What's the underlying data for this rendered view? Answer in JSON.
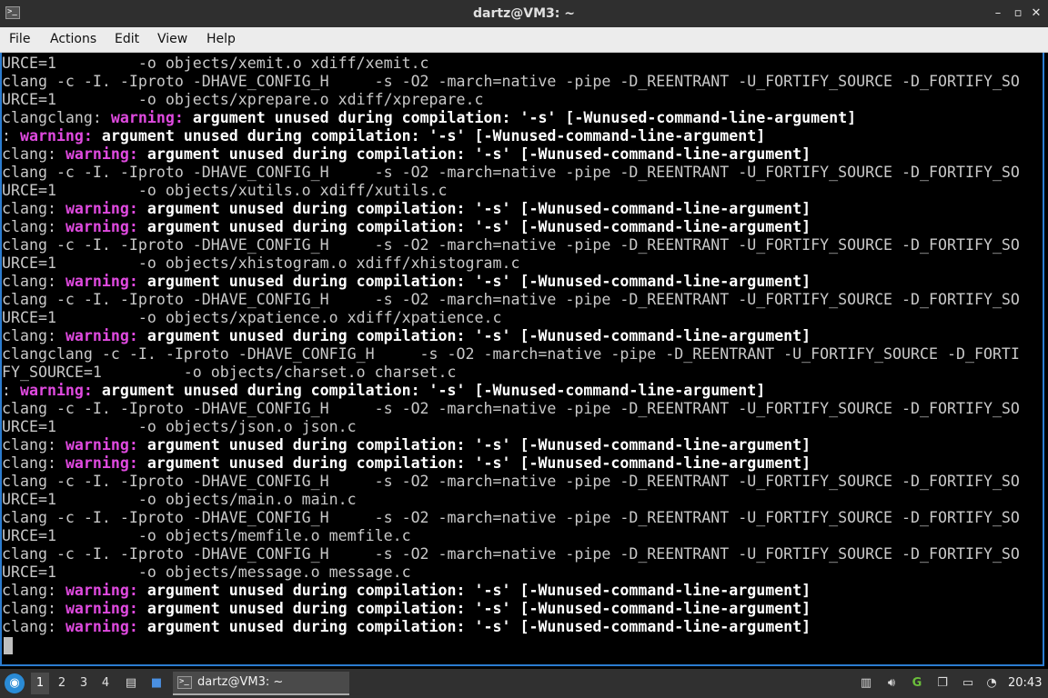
{
  "window": {
    "title": "dartz@VM3: ~",
    "minimize_icon": "minimize-icon",
    "maximize_icon": "maximize-icon",
    "close_icon": "close-icon"
  },
  "menu": [
    "File",
    "Actions",
    "Edit",
    "View",
    "Help"
  ],
  "terminal": {
    "lines": [
      [
        [
          "URCE=1         -o objects/xemit.o xdiff/xemit.c",
          "n"
        ]
      ],
      [
        [
          "clang -c -I. -Iproto -DHAVE_CONFIG_H     -s -O2 -march=native -pipe -D_REENTRANT -U_FORTIFY_SOURCE -D_FORTIFY_SO",
          "n"
        ]
      ],
      [
        [
          "URCE=1         -o objects/xprepare.o xdiff/xprepare.c",
          "n"
        ]
      ],
      [
        [
          "clangclang: ",
          "n"
        ],
        [
          "warning: ",
          "w"
        ],
        [
          "argument unused during compilation: '-s' [-Wunused-command-line-argument]",
          "b"
        ]
      ],
      [
        [
          ": ",
          "n"
        ],
        [
          "warning: ",
          "w"
        ],
        [
          "argument unused during compilation: '-s' [-Wunused-command-line-argument]",
          "b"
        ]
      ],
      [
        [
          "clang: ",
          "n"
        ],
        [
          "warning: ",
          "w"
        ],
        [
          "argument unused during compilation: '-s' [-Wunused-command-line-argument]",
          "b"
        ]
      ],
      [
        [
          "clang -c -I. -Iproto -DHAVE_CONFIG_H     -s -O2 -march=native -pipe -D_REENTRANT -U_FORTIFY_SOURCE -D_FORTIFY_SO",
          "n"
        ]
      ],
      [
        [
          "URCE=1         -o objects/xutils.o xdiff/xutils.c",
          "n"
        ]
      ],
      [
        [
          "clang: ",
          "n"
        ],
        [
          "warning: ",
          "w"
        ],
        [
          "argument unused during compilation: '-s' [-Wunused-command-line-argument]",
          "b"
        ]
      ],
      [
        [
          "clang: ",
          "n"
        ],
        [
          "warning: ",
          "w"
        ],
        [
          "argument unused during compilation: '-s' [-Wunused-command-line-argument]",
          "b"
        ]
      ],
      [
        [
          "clang -c -I. -Iproto -DHAVE_CONFIG_H     -s -O2 -march=native -pipe -D_REENTRANT -U_FORTIFY_SOURCE -D_FORTIFY_SO",
          "n"
        ]
      ],
      [
        [
          "URCE=1         -o objects/xhistogram.o xdiff/xhistogram.c",
          "n"
        ]
      ],
      [
        [
          "clang: ",
          "n"
        ],
        [
          "warning: ",
          "w"
        ],
        [
          "argument unused during compilation: '-s' [-Wunused-command-line-argument]",
          "b"
        ]
      ],
      [
        [
          "clang -c -I. -Iproto -DHAVE_CONFIG_H     -s -O2 -march=native -pipe -D_REENTRANT -U_FORTIFY_SOURCE -D_FORTIFY_SO",
          "n"
        ]
      ],
      [
        [
          "URCE=1         -o objects/xpatience.o xdiff/xpatience.c",
          "n"
        ]
      ],
      [
        [
          "clang: ",
          "n"
        ],
        [
          "warning: ",
          "w"
        ],
        [
          "argument unused during compilation: '-s' [-Wunused-command-line-argument]",
          "b"
        ]
      ],
      [
        [
          "clangclang -c -I. -Iproto -DHAVE_CONFIG_H     -s -O2 -march=native -pipe -D_REENTRANT -U_FORTIFY_SOURCE -D_FORTI",
          "n"
        ]
      ],
      [
        [
          "FY_SOURCE=1         -o objects/charset.o charset.c",
          "n"
        ]
      ],
      [
        [
          ": ",
          "n"
        ],
        [
          "warning: ",
          "w"
        ],
        [
          "argument unused during compilation: '-s' [-Wunused-command-line-argument]",
          "b"
        ]
      ],
      [
        [
          "clang -c -I. -Iproto -DHAVE_CONFIG_H     -s -O2 -march=native -pipe -D_REENTRANT -U_FORTIFY_SOURCE -D_FORTIFY_SO",
          "n"
        ]
      ],
      [
        [
          "URCE=1         -o objects/json.o json.c",
          "n"
        ]
      ],
      [
        [
          "clang: ",
          "n"
        ],
        [
          "warning: ",
          "w"
        ],
        [
          "argument unused during compilation: '-s' [-Wunused-command-line-argument]",
          "b"
        ]
      ],
      [
        [
          "clang: ",
          "n"
        ],
        [
          "warning: ",
          "w"
        ],
        [
          "argument unused during compilation: '-s' [-Wunused-command-line-argument]",
          "b"
        ]
      ],
      [
        [
          "clang -c -I. -Iproto -DHAVE_CONFIG_H     -s -O2 -march=native -pipe -D_REENTRANT -U_FORTIFY_SOURCE -D_FORTIFY_SO",
          "n"
        ]
      ],
      [
        [
          "URCE=1         -o objects/main.o main.c",
          "n"
        ]
      ],
      [
        [
          "clang -c -I. -Iproto -DHAVE_CONFIG_H     -s -O2 -march=native -pipe -D_REENTRANT -U_FORTIFY_SOURCE -D_FORTIFY_SO",
          "n"
        ]
      ],
      [
        [
          "URCE=1         -o objects/memfile.o memfile.c",
          "n"
        ]
      ],
      [
        [
          "clang -c -I. -Iproto -DHAVE_CONFIG_H     -s -O2 -march=native -pipe -D_REENTRANT -U_FORTIFY_SOURCE -D_FORTIFY_SO",
          "n"
        ]
      ],
      [
        [
          "URCE=1         -o objects/message.o message.c",
          "n"
        ]
      ],
      [
        [
          "clang: ",
          "n"
        ],
        [
          "warning: ",
          "w"
        ],
        [
          "argument unused during compilation: '-s' [-Wunused-command-line-argument]",
          "b"
        ]
      ],
      [
        [
          "clang: ",
          "n"
        ],
        [
          "warning: ",
          "w"
        ],
        [
          "argument unused during compilation: '-s' [-Wunused-command-line-argument]",
          "b"
        ]
      ],
      [
        [
          "clang: ",
          "n"
        ],
        [
          "warning: ",
          "w"
        ],
        [
          "argument unused during compilation: '-s' [-Wunused-command-line-argument]",
          "b"
        ]
      ]
    ]
  },
  "taskbar": {
    "start_icon": "start-menu-icon",
    "workspaces": [
      "1",
      "2",
      "3",
      "4"
    ],
    "active_workspace": "1",
    "task_label": "dartz@VM3: ~",
    "clock": "20:43",
    "tray_icons": [
      "trash-icon",
      "volume-icon",
      "network-icon",
      "clipboard-icon",
      "display-icon",
      "update-icon"
    ]
  },
  "colors": {
    "accent": "#2b7cd0",
    "warning": "#e04ae0",
    "terminal_bg": "#000000",
    "terminal_fg": "#c8c8c8"
  }
}
